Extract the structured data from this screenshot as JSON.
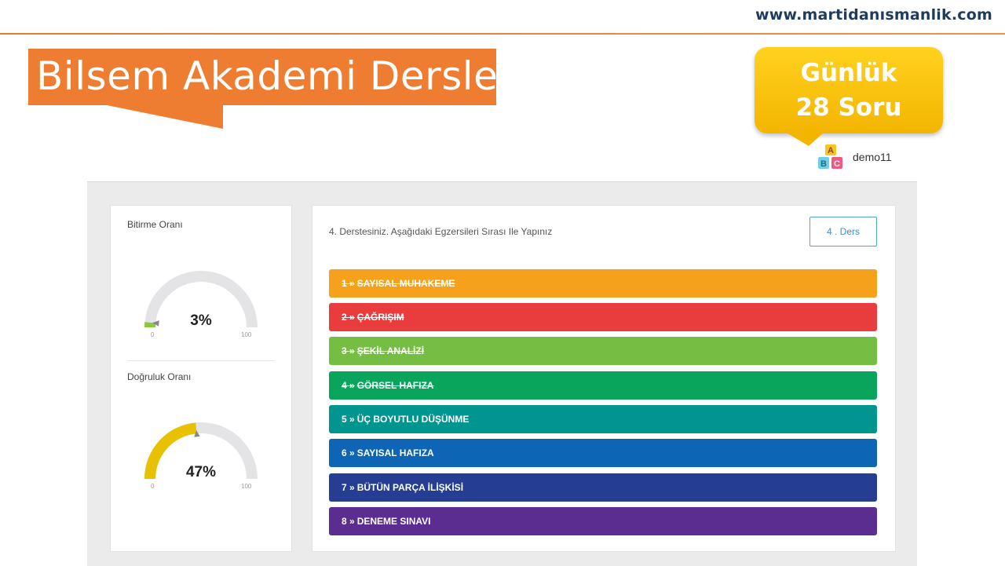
{
  "header": {
    "site_url": "www.martidanısmanlik.com",
    "title": "Bilsem Akademi Dersler",
    "callout": "Günlük 28 Soru",
    "user_name": "demo11",
    "avatar_letters": [
      "A",
      "B",
      "C"
    ]
  },
  "stats": {
    "completion": {
      "label": "Bitirme Oranı",
      "value_text": "3%",
      "value": 3,
      "min": "0",
      "max": "100",
      "color": "#8dc63f"
    },
    "accuracy": {
      "label": "Doğruluk Oranı",
      "value_text": "47%",
      "value": 47,
      "min": "0",
      "max": "100",
      "color": "#e8c100"
    }
  },
  "lesson": {
    "instruction": "4. Derstesiniz. Aşağıdaki Egzersileri Sırası Ile Yapınız",
    "button_label": "4 . Ders",
    "exercises": [
      {
        "num": "1 »",
        "label": "SAYISAL MUHAKEME",
        "color": "#f6a11c",
        "done": true
      },
      {
        "num": "2 »",
        "label": "ÇAĞRIŞIM",
        "color": "#e93c3c",
        "done": true
      },
      {
        "num": "3 »",
        "label": "ŞEKİL ANALİZİ",
        "color": "#76bd43",
        "done": true
      },
      {
        "num": "4 »",
        "label": "GÖRSEL HAFIZA",
        "color": "#0aa55c",
        "done": true
      },
      {
        "num": "5 »",
        "label": "ÜÇ BOYUTLU DÜŞÜNME",
        "color": "#00958f",
        "done": false
      },
      {
        "num": "6 »",
        "label": "SAYISAL HAFIZA",
        "color": "#0e64b5",
        "done": false
      },
      {
        "num": "7 »",
        "label": "BÜTÜN PARÇA İLİŞKİSİ",
        "color": "#253d92",
        "done": false
      },
      {
        "num": "8 »",
        "label": "DENEME SINAVI",
        "color": "#5b2d91",
        "done": false
      }
    ]
  }
}
